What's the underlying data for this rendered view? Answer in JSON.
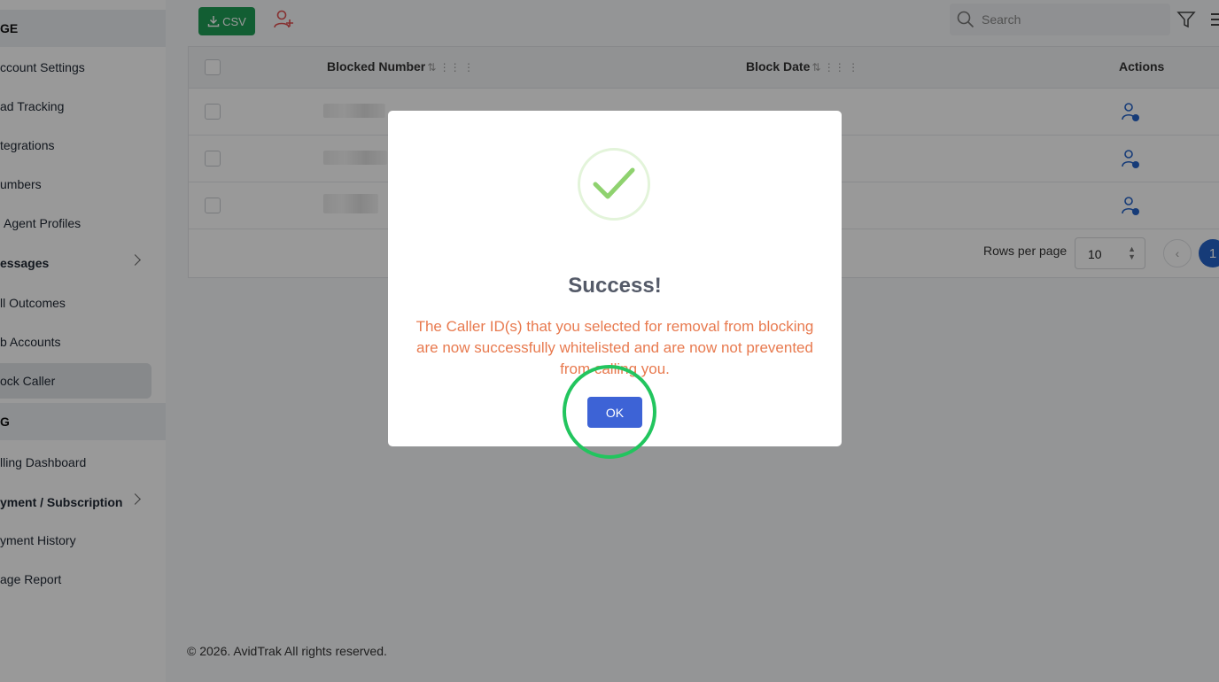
{
  "sidebar": {
    "section_manage": "GE",
    "items": [
      {
        "label": "ccount Settings"
      },
      {
        "label": "ad Tracking"
      },
      {
        "label": "tegrations"
      },
      {
        "label": "umbers"
      },
      {
        "label": "Agent Profiles"
      },
      {
        "label": "essages"
      },
      {
        "label": "ll Outcomes"
      },
      {
        "label": "b Accounts"
      },
      {
        "label": "ock Caller"
      }
    ],
    "section_billing": "G",
    "billing_items": [
      {
        "label": "lling Dashboard"
      },
      {
        "label": "yment / Subscription"
      },
      {
        "label": "yment History"
      },
      {
        "label": "age Report"
      }
    ]
  },
  "toolbar": {
    "csv_label": "CSV",
    "add_user_icon": "user-plus-icon",
    "search_placeholder": "Search",
    "filter_icon": "filter-icon",
    "menu_icon": "menu-icon"
  },
  "table": {
    "columns": [
      "Blocked Number",
      "Block Date",
      "Actions"
    ],
    "rows": 3,
    "row_action_icon": "user-check-icon"
  },
  "pagination": {
    "rows_per_page_label": "Rows per page",
    "rows_per_page_value": "10",
    "current_page": "1"
  },
  "footer": {
    "text": "© 2026. AvidTrak All rights reserved."
  },
  "modal": {
    "icon": "success-check-icon",
    "title": "Success!",
    "message": "The Caller ID(s) that you selected for removal from blocking are now successfully whitelisted and are now not prevented from calling you.",
    "ok_label": "OK"
  },
  "colors": {
    "csv_button": "#1f9d55",
    "ok_button": "#3d63d6",
    "message_text": "#e87a4f",
    "highlight_ring": "#22c55e",
    "success_check": "#8fd26f"
  }
}
